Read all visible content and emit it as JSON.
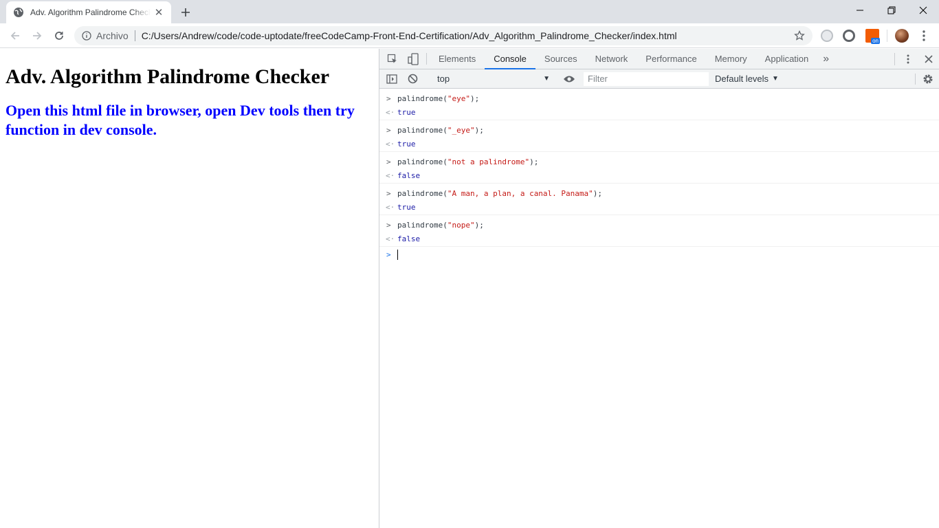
{
  "browser": {
    "tab": {
      "title": "Adv. Algorithm Palindrome Checker",
      "close_glyph": "✕"
    },
    "new_tab_glyph": "+",
    "window_controls": {
      "minimize": "minimize-icon",
      "restore": "restore-icon",
      "close": "close-icon"
    },
    "omnibox": {
      "scheme_label": "Archivo",
      "url": "C:/Users/Andrew/code/code-uptodate/freeCodeCamp-Front-End-Certification/Adv_Algorithm_Palindrome_Checker/index.html"
    },
    "extension_badge": "on"
  },
  "page": {
    "heading": "Adv. Algorithm Palindrome Checker",
    "subheading": "Open this html file in browser, open Dev tools then try function in dev console."
  },
  "devtools": {
    "tabs": [
      {
        "label": "Elements",
        "active": false
      },
      {
        "label": "Console",
        "active": true
      },
      {
        "label": "Sources",
        "active": false
      },
      {
        "label": "Network",
        "active": false
      },
      {
        "label": "Performance",
        "active": false
      },
      {
        "label": "Memory",
        "active": false
      },
      {
        "label": "Application",
        "active": false
      }
    ],
    "more_tabs_glyph": "»",
    "toolbar": {
      "context": "top",
      "filter_placeholder": "Filter",
      "levels_label": "Default levels"
    },
    "console_entries": [
      {
        "fn": "palindrome(",
        "arg": "\"eye\"",
        "tail": ");",
        "result": "true"
      },
      {
        "fn": "palindrome(",
        "arg": "\"_eye\"",
        "tail": ");",
        "result": "true"
      },
      {
        "fn": "palindrome(",
        "arg": "\"not a palindrome\"",
        "tail": ");",
        "result": "false"
      },
      {
        "fn": "palindrome(",
        "arg": "\"A man, a plan, a canal. Panama\"",
        "tail": ");",
        "result": "true"
      },
      {
        "fn": "palindrome(",
        "arg": "\"nope\"",
        "tail": ");",
        "result": "false"
      }
    ],
    "prompt_glyph": ">",
    "result_glyph": "<·"
  },
  "colors": {
    "accent": "#1a73e8",
    "string": "#c41a16",
    "boolean": "#1a1aa6",
    "heading_blue": "#0000ff"
  }
}
